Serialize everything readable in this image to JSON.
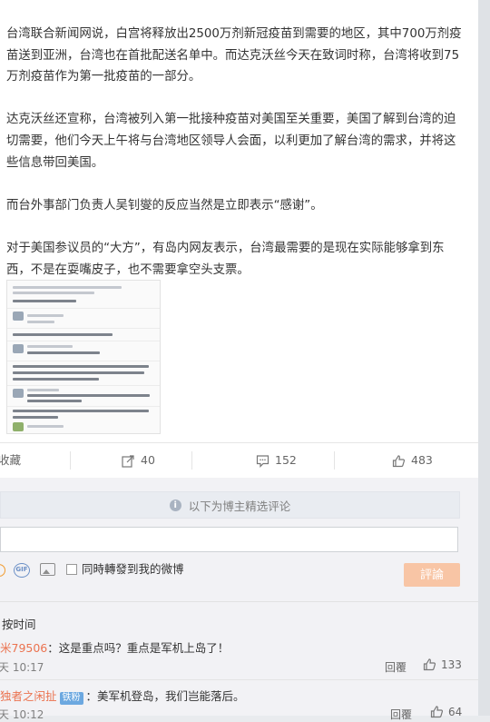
{
  "post": {
    "paragraphs": [
      "台湾联合新闻网说，白宫将释放出2500万剂新冠疫苗到需要的地区，其中700万剂疫苗送到亚洲，台湾也在首批配送名单中。而达克沃丝今天在致词时称，台湾将收到75万剂疫苗作为第一批疫苗的一部分。",
      "达克沃丝还宣称，台湾被列入第一批接种疫苗对美国至关重要，美国了解到台湾的迫切需要，他们今天上午将与台湾地区领导人会面，以利更加了解台湾的需求，并将这些信息带回美国。",
      "而台外事部门负责人吴钊燮的反应当然是立即表示“感谢”。",
      "对于美国参议员的“大方”，有岛内网友表示，台湾最需要的是现在实际能够拿到东西，不是在耍嘴皮子，也不需要拿空头支票。"
    ]
  },
  "actions": {
    "favorite": "收藏",
    "repost_count": "40",
    "comment_count": "152",
    "like_count": "483"
  },
  "comments_section": {
    "notice": "以下为博主精选评论",
    "input_value": "",
    "gif_label": "GIF",
    "repost_checkbox_label": "同時轉發到我的微博",
    "submit_label": "評論",
    "sort_label": "按时间",
    "comments": [
      {
        "user": "米79506",
        "text": "：这是重点吗？重点是军机上岛了！",
        "time": "天 10:17",
        "reply_label": "回覆",
        "likes": "133"
      },
      {
        "user": "独者之闲扯",
        "badge": "铁粉",
        "text": "：美军机登岛，我们岂能落后。",
        "time": "天 10:12",
        "reply_label": "回覆",
        "likes": "64"
      }
    ]
  },
  "colors": {
    "accent": "#eb7350",
    "submit_disabled": "#f8c5a5"
  }
}
